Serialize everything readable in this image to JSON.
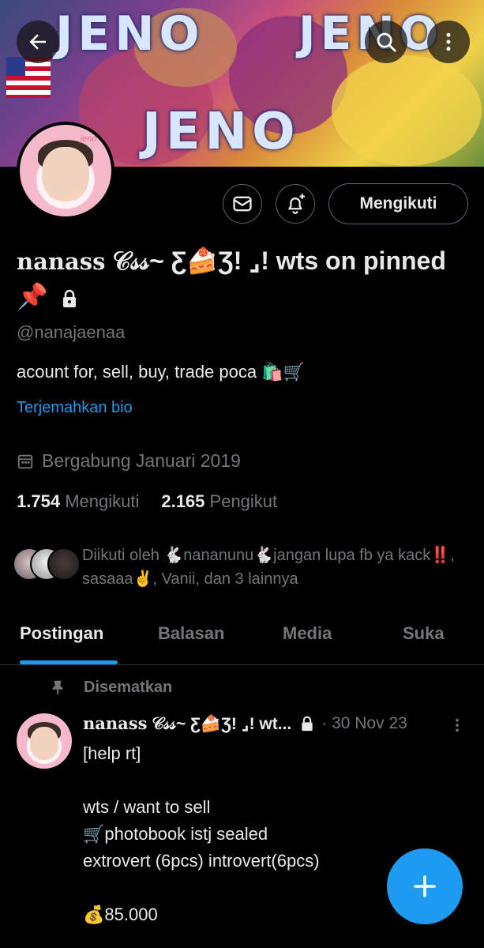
{
  "banner": {
    "watermarks": [
      "JENO",
      "JENO",
      "JENO"
    ]
  },
  "header": {
    "back_icon": "arrow-left-icon",
    "search_icon": "search-icon",
    "more_icon": "more-vertical-icon"
  },
  "profile": {
    "avatar_tag": "jeno",
    "follow_label": "Mengikuti",
    "display_name_latin": "nanass",
    "display_name_rest": " 𝒞𝓈𝓈~ Ƹ🍰Ʒ! ⌟! wts on pinned",
    "name_emoji": "📌",
    "handle": "@nanajaenaa",
    "bio": "acount for, sell, buy, trade poca 🛍️🛒",
    "translate_label": "Terjemahkan bio",
    "joined": "Bergabung Januari 2019",
    "following_count": "1.754",
    "following_label": "Mengikuti",
    "followers_count": "2.165",
    "followers_label": "Pengikut",
    "followed_by": "Diikuti oleh 🐇nananunu🐇jangan lupa fb ya kack‼️, sasaaa✌️, Vanii, dan 3 lainnya"
  },
  "tabs": [
    "Postingan",
    "Balasan",
    "Media",
    "Suka"
  ],
  "pinned_post": {
    "pinned_label": "Disematkan",
    "author_latin": "nanass",
    "author_rest": " 𝒞𝓈𝓈~ Ƹ🍰Ʒ! ⌟! wt...",
    "date": "· 30 Nov 23",
    "text": "[help rt]\n\nwts / want to sell\n🛒photobook istj sealed\nextrovert (6pcs) introvert(6pcs)\n\n💰85.000"
  },
  "colors": {
    "accent": "#1d9bf0",
    "background": "#000000",
    "muted": "#71767b"
  }
}
